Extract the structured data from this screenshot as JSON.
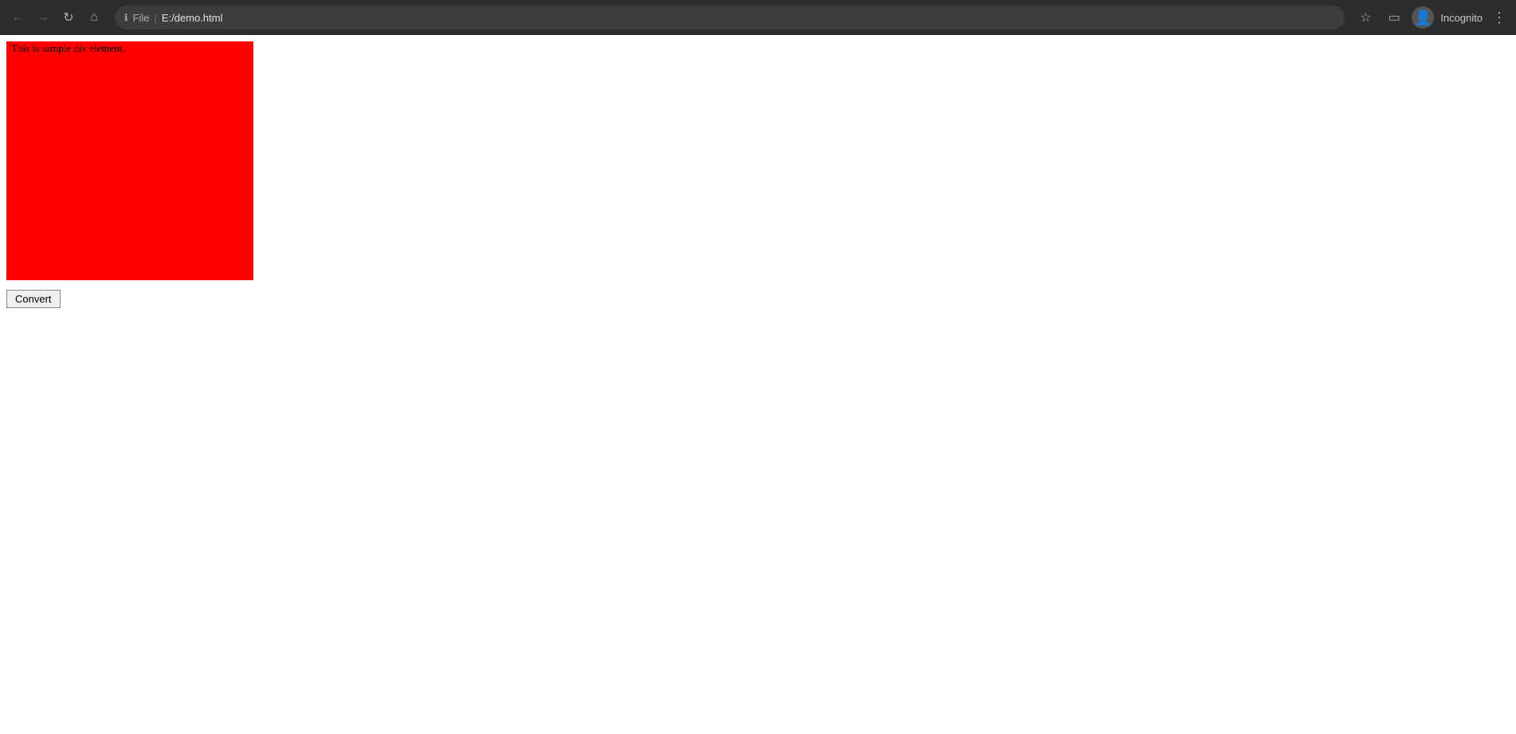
{
  "browser": {
    "back_label": "←",
    "forward_label": "→",
    "reload_label": "↻",
    "home_label": "⌂",
    "address_icon": "ℹ",
    "file_label": "File",
    "separator": "|",
    "url": "E:/demo.html",
    "bookmark_label": "☆",
    "split_screen_label": "▭",
    "incognito_label": "Incognito",
    "menu_label": "⋮"
  },
  "page": {
    "div_text": "This is sample div element.",
    "button_label": "Convert",
    "div_bg_color": "#ff0000"
  }
}
